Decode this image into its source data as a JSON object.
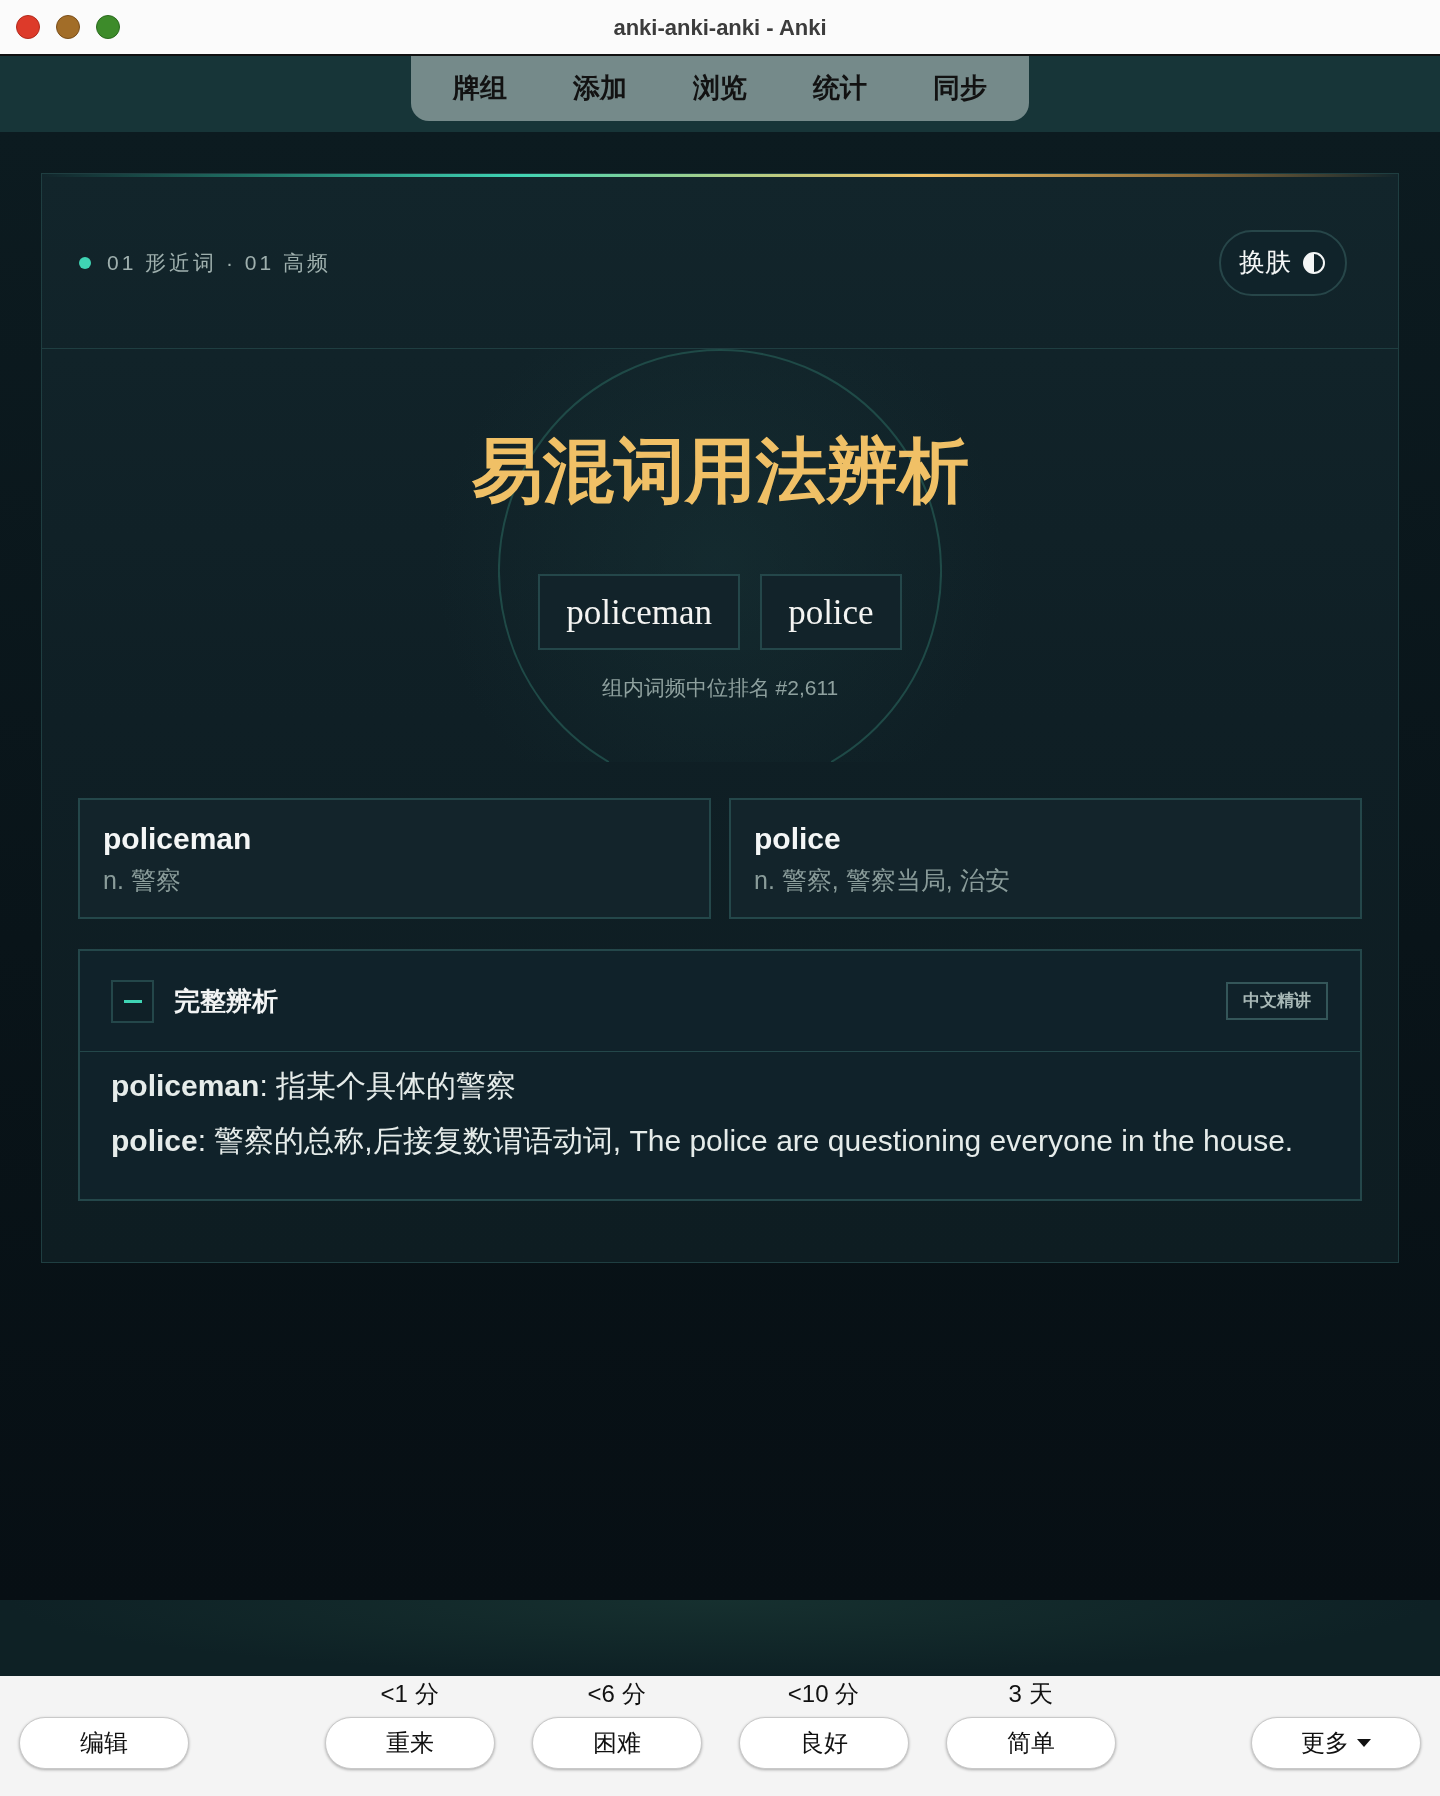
{
  "window": {
    "title": "anki-anki-anki - Anki"
  },
  "top_nav": {
    "tabs": [
      {
        "label": "牌组"
      },
      {
        "label": "添加"
      },
      {
        "label": "浏览"
      },
      {
        "label": "统计"
      },
      {
        "label": "同步"
      }
    ]
  },
  "card": {
    "header": {
      "meta": "01 形近词 · 01 高频",
      "skin_button": "换肤"
    },
    "hero": {
      "title": "易混词用法辨析",
      "words": [
        "policeman",
        "police"
      ],
      "rank": "组内词频中位排名 #2,611"
    },
    "definitions": [
      {
        "word": "policeman",
        "meaning": "n. 警察"
      },
      {
        "word": "police",
        "meaning": "n. 警察, 警察当局, 治安"
      }
    ],
    "analysis": {
      "title": "完整辨析",
      "badge": "中文精讲",
      "expanded": true,
      "lines": [
        "**policeman**: 指某个具体的警察",
        "**police**: 警察的总称,后接复数谓语动词, The police are questioning everyone in the house."
      ]
    }
  },
  "answer_bar": {
    "buttons": [
      {
        "kind": "plain",
        "label": "编辑"
      },
      {
        "kind": "ease",
        "label": "重来",
        "interval": "<1 分"
      },
      {
        "kind": "ease",
        "label": "困难",
        "interval": "<6 分"
      },
      {
        "kind": "ease",
        "label": "良好",
        "interval": "<10 分"
      },
      {
        "kind": "ease",
        "label": "简单",
        "interval": "3 天"
      },
      {
        "kind": "menu",
        "label": "更多"
      }
    ]
  }
}
